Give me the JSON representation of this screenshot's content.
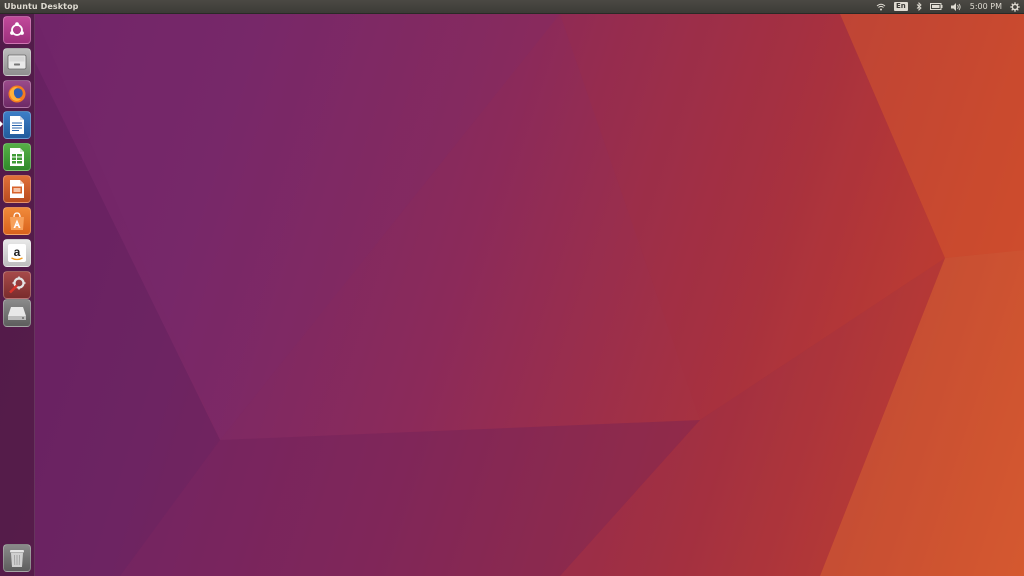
{
  "panel": {
    "title": "Ubuntu Desktop",
    "keyboard_layout": "En",
    "clock": "5:00 PM",
    "indicators": [
      "wifi-icon",
      "keyboard-layout-indicator",
      "bluetooth-icon",
      "battery-icon",
      "volume-icon",
      "clock",
      "system-gear-icon"
    ]
  },
  "launcher": {
    "items": [
      {
        "name": "dash-home",
        "icon": "ubuntu-logo-icon"
      },
      {
        "name": "files",
        "icon": "file-cabinet-icon"
      },
      {
        "name": "firefox",
        "icon": "firefox-icon"
      },
      {
        "name": "libreoffice-writer",
        "icon": "writer-document-icon",
        "running": true
      },
      {
        "name": "libreoffice-calc",
        "icon": "calc-spreadsheet-icon"
      },
      {
        "name": "libreoffice-impress",
        "icon": "impress-presentation-icon"
      },
      {
        "name": "ubuntu-software",
        "icon": "software-center-bag-icon"
      },
      {
        "name": "amazon",
        "icon": "amazon-icon"
      },
      {
        "name": "system-settings",
        "icon": "settings-wrench-icon"
      },
      {
        "name": "removable-drive",
        "icon": "drive-icon"
      },
      {
        "name": "trash",
        "icon": "trash-icon"
      }
    ]
  },
  "colors": {
    "panel_bg": "#3c3b37",
    "panel_text": "#dfdbd2",
    "wallpaper_left": "#6e2368",
    "wallpaper_right": "#d44d2a",
    "dash_home": "#b33d8f"
  }
}
